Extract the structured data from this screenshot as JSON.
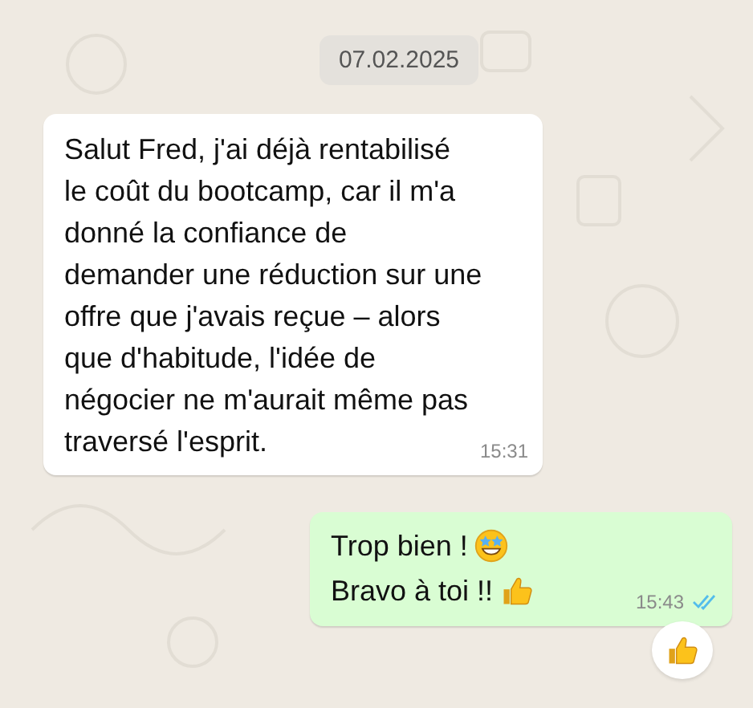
{
  "date_chip": "07.02.2025",
  "messages": [
    {
      "kind": "incoming",
      "lines": [
        "Salut Fred, j'ai déjà rentabilisé",
        "le coût du bootcamp, car il m'a",
        "donné la confiance de",
        "demander une réduction sur une",
        "offre que j'avais reçue – alors",
        "que d'habitude, l'idée de",
        "négocier ne m'aurait même pas",
        "traversé l'esprit."
      ],
      "time": "15:31"
    },
    {
      "kind": "outgoing",
      "parts": [
        {
          "text": "Trop bien !",
          "kind": "star_struck"
        },
        {
          "text": "Bravo à toi !!",
          "kind": "thumbs_up"
        }
      ],
      "time": "15:43",
      "read": true,
      "reaction": {
        "kind": "thumbs_up"
      }
    }
  ]
}
